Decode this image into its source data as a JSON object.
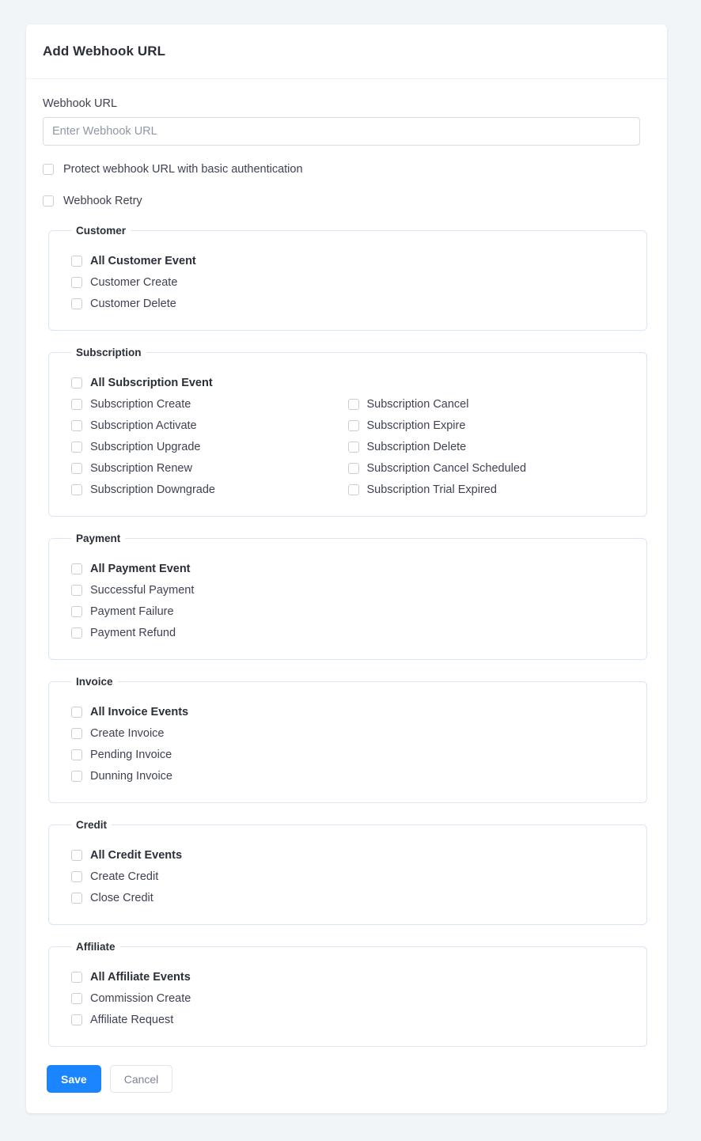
{
  "card": {
    "title": "Add Webhook URL"
  },
  "form": {
    "url_label": "Webhook URL",
    "url_value": "",
    "url_placeholder": "Enter Webhook URL",
    "options": [
      {
        "label": "Protect webhook URL with basic authentication",
        "checked": false
      },
      {
        "label": "Webhook Retry",
        "checked": false
      }
    ]
  },
  "groups": [
    {
      "legend": "Customer",
      "columns": [
        [
          {
            "label": "All Customer Event",
            "bold": true,
            "checked": false
          },
          {
            "label": "Customer Create",
            "bold": false,
            "checked": false
          },
          {
            "label": "Customer Delete",
            "bold": false,
            "checked": false
          }
        ]
      ]
    },
    {
      "legend": "Subscription",
      "columns": [
        [
          {
            "label": "All Subscription Event",
            "bold": true,
            "checked": false
          },
          {
            "label": "Subscription Create",
            "bold": false,
            "checked": false
          },
          {
            "label": "Subscription Activate",
            "bold": false,
            "checked": false
          },
          {
            "label": "Subscription Upgrade",
            "bold": false,
            "checked": false
          },
          {
            "label": "Subscription Renew",
            "bold": false,
            "checked": false
          },
          {
            "label": "Subscription Downgrade",
            "bold": false,
            "checked": false
          }
        ],
        [
          {
            "label": "",
            "bold": false,
            "checked": false,
            "spacer": true
          },
          {
            "label": "Subscription Cancel",
            "bold": false,
            "checked": false
          },
          {
            "label": "Subscription Expire",
            "bold": false,
            "checked": false
          },
          {
            "label": "Subscription Delete",
            "bold": false,
            "checked": false
          },
          {
            "label": "Subscription Cancel Scheduled",
            "bold": false,
            "checked": false
          },
          {
            "label": "Subscription Trial Expired",
            "bold": false,
            "checked": false
          }
        ]
      ]
    },
    {
      "legend": "Payment",
      "columns": [
        [
          {
            "label": "All Payment Event",
            "bold": true,
            "checked": false
          },
          {
            "label": "Successful Payment",
            "bold": false,
            "checked": false
          },
          {
            "label": "Payment Failure",
            "bold": false,
            "checked": false
          },
          {
            "label": "Payment Refund",
            "bold": false,
            "checked": false
          }
        ]
      ]
    },
    {
      "legend": "Invoice",
      "columns": [
        [
          {
            "label": "All Invoice Events",
            "bold": true,
            "checked": false
          },
          {
            "label": "Create Invoice",
            "bold": false,
            "checked": false
          },
          {
            "label": "Pending Invoice",
            "bold": false,
            "checked": false
          },
          {
            "label": "Dunning Invoice",
            "bold": false,
            "checked": false
          }
        ]
      ]
    },
    {
      "legend": "Credit",
      "columns": [
        [
          {
            "label": "All Credit Events",
            "bold": true,
            "checked": false
          },
          {
            "label": "Create Credit",
            "bold": false,
            "checked": false
          },
          {
            "label": "Close Credit",
            "bold": false,
            "checked": false
          }
        ]
      ]
    },
    {
      "legend": "Affiliate",
      "columns": [
        [
          {
            "label": "All Affiliate Events",
            "bold": true,
            "checked": false
          },
          {
            "label": "Commission Create",
            "bold": false,
            "checked": false
          },
          {
            "label": "Affiliate Request",
            "bold": false,
            "checked": false
          }
        ]
      ]
    }
  ],
  "footer": {
    "save_label": "Save",
    "cancel_label": "Cancel"
  },
  "colors": {
    "page_background": "#f1f5f8",
    "primary": "#1b84ff",
    "fieldset_border": "#dbe6f4",
    "text": "#3f4254"
  }
}
